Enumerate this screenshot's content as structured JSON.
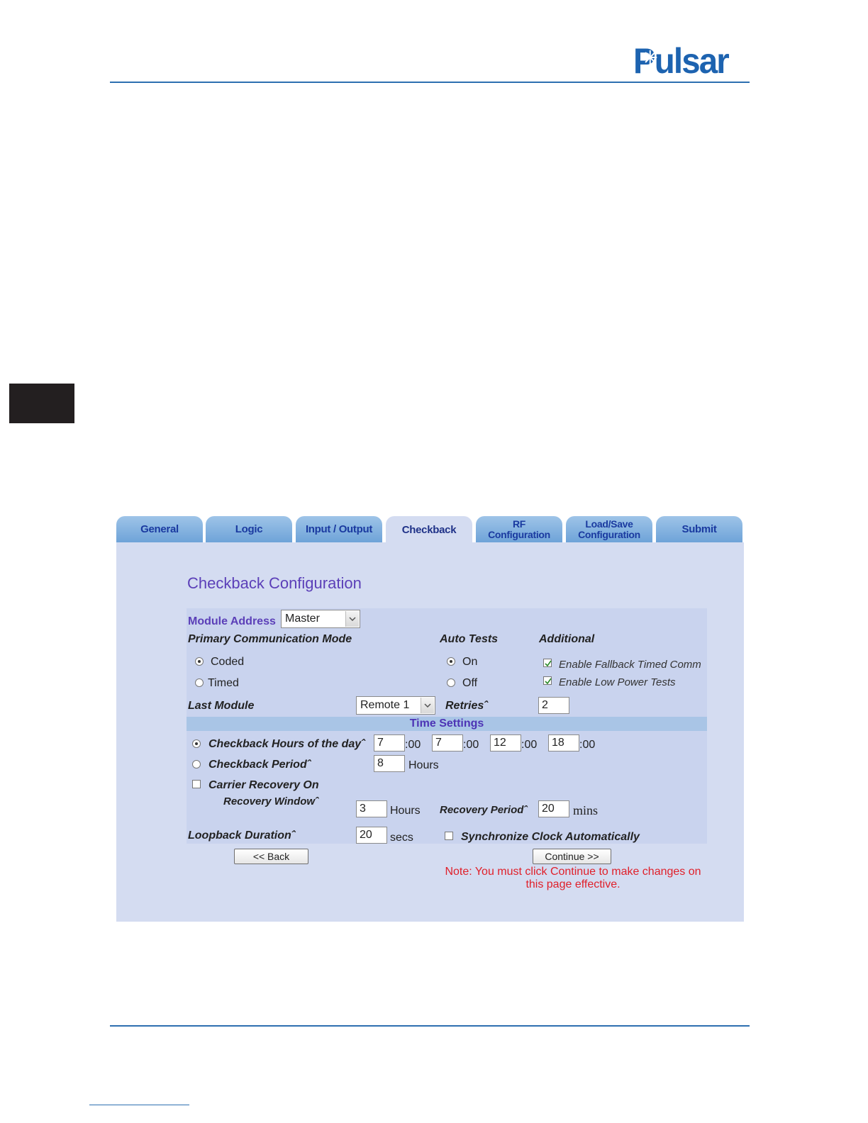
{
  "brand": {
    "logo_text": "Pulsar"
  },
  "tabs": [
    {
      "label": "General"
    },
    {
      "label": "Logic"
    },
    {
      "label": "Input / Output"
    },
    {
      "label": "Checkback"
    },
    {
      "label": "RF\nConfiguration"
    },
    {
      "label": "Load/Save\nConfiguration"
    },
    {
      "label": "Submit"
    }
  ],
  "form": {
    "title": "Checkback Configuration",
    "module_address": {
      "label": "Module Address",
      "value": "Master"
    },
    "primary_mode": {
      "label": "Primary Communication Mode",
      "coded": "Coded",
      "timed": "Timed",
      "selected": "Coded"
    },
    "auto_tests": {
      "label": "Auto Tests",
      "on": "On",
      "off": "Off",
      "selected": "On"
    },
    "additional": {
      "label": "Additional",
      "fallback": "Enable Fallback Timed Comm",
      "low_power": "Enable Low Power Tests"
    },
    "last_module": {
      "label": "Last Module",
      "value": "Remote 1"
    },
    "retries": {
      "label": "Retriesˆ",
      "value": "2"
    },
    "time_settings": "Time Settings",
    "checkback_hours": {
      "label": "Checkback Hours of the dayˆ",
      "values": [
        "7",
        "7",
        "12",
        "18"
      ],
      "suffix": ":00"
    },
    "checkback_period": {
      "label": "Checkback Periodˆ",
      "value": "8",
      "unit": "Hours"
    },
    "carrier_recovery": {
      "label": "Carrier Recovery On"
    },
    "recovery_window": {
      "label": "Recovery Windowˆ",
      "value": "3",
      "unit": "Hours"
    },
    "recovery_period": {
      "label": "Recovery Periodˆ",
      "value": "20",
      "unit": "mins"
    },
    "loopback": {
      "label": "Loopback Durationˆ",
      "value": "20",
      "unit": "secs"
    },
    "sync_clock": {
      "label": "Synchronize Clock Automatically"
    },
    "back_button": "<< Back",
    "continue_button": "Continue >>",
    "note": "Note: You must click Continue to make changes on this page effective."
  },
  "colors": {
    "accent": "#5b3fb8",
    "tab": "#6ea3d8",
    "panel": "#d4dcf1",
    "note": "#e0202a",
    "logo": "#1d63b0"
  }
}
